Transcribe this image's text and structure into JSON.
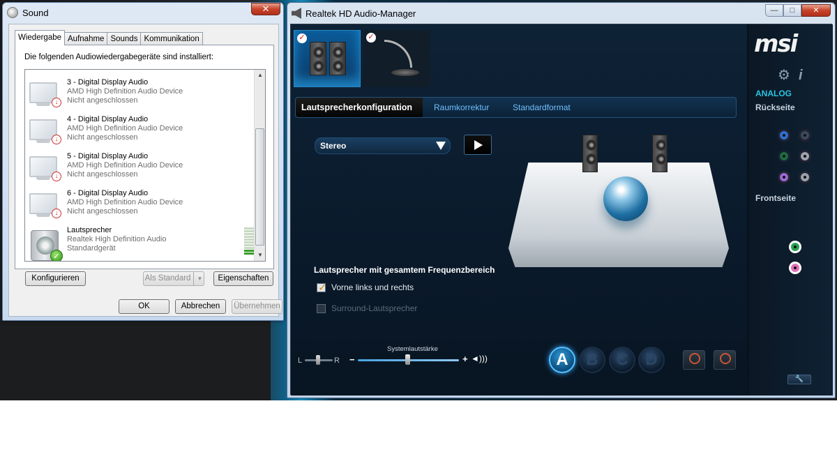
{
  "sound": {
    "title": "Sound",
    "close": "✕",
    "tabs": [
      "Wiedergabe",
      "Aufnahme",
      "Sounds",
      "Kommunikation"
    ],
    "caption": "Die folgenden Audiowiedergabegeräte sind installiert:",
    "devices": [
      {
        "name": "3 - Digital Display Audio",
        "driver": "AMD High Definition Audio Device",
        "status": "Nicht angeschlossen"
      },
      {
        "name": "4 - Digital Display Audio",
        "driver": "AMD High Definition Audio Device",
        "status": "Nicht angeschlossen"
      },
      {
        "name": "5 - Digital Display Audio",
        "driver": "AMD High Definition Audio Device",
        "status": "Nicht angeschlossen"
      },
      {
        "name": "6 - Digital Display Audio",
        "driver": "AMD High Definition Audio Device",
        "status": "Nicht angeschlossen"
      },
      {
        "name": "Lautsprecher",
        "driver": "Realtek High Definition Audio",
        "status": "Standardgerät"
      }
    ],
    "level_meter": {
      "segments": 10,
      "active": 2
    },
    "buttons": {
      "configure": "Konfigurieren",
      "set_default": "Als Standard",
      "properties": "Eigenschaften",
      "ok": "OK",
      "cancel": "Abbrechen",
      "apply": "Übernehmen"
    }
  },
  "realtek": {
    "title": "Realtek HD Audio-Manager",
    "window_controls": {
      "minimize": "—",
      "maximize": "□",
      "close": "✕"
    },
    "sub_tabs": [
      "Lautsprecherkonfiguration",
      "Raumkorrektur",
      "Standardformat"
    ],
    "speaker_config": {
      "selected": "Stereo"
    },
    "full_range_title": "Lautsprecher mit gesamtem Frequenzbereich",
    "checkboxes": [
      {
        "label": "Vorne links und rechts",
        "checked": true,
        "enabled": true
      },
      {
        "label": "Surround-Lautsprecher",
        "checked": false,
        "enabled": false
      }
    ],
    "balance": {
      "left": "L",
      "right": "R",
      "value": 0.5
    },
    "volume": {
      "caption": "Systemlautstärke",
      "minus": "−",
      "plus": "+",
      "value": 0.5
    },
    "profiles": [
      "A",
      "B",
      "C",
      "D"
    ],
    "active_profile": "A",
    "sidebar": {
      "logo": "msi",
      "analog": "ANALOG",
      "rear": "Rückseite",
      "front": "Frontseite"
    },
    "colors": {
      "jack_blue": "#2f6fd1",
      "jack_green": "#2aa052",
      "jack_pink": "#e070b8",
      "jack_gray": "#9aa3ab",
      "jack_purple": "#9a6ad0",
      "accent": "#2ea8ff"
    }
  }
}
